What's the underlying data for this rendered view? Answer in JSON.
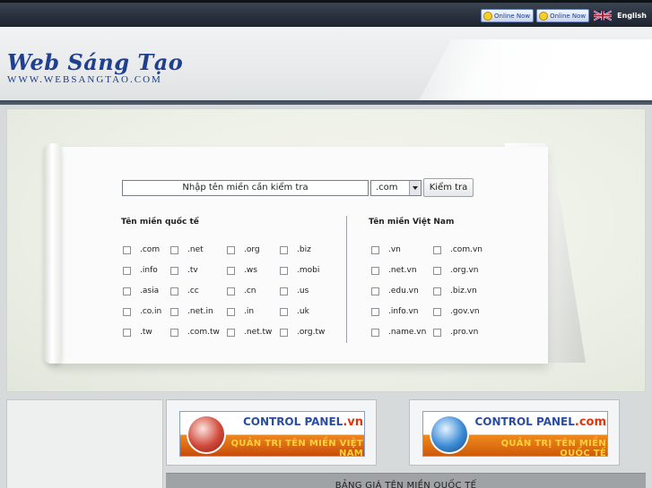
{
  "topbar": {
    "online_buttons": [
      {
        "label": "Online Now"
      },
      {
        "label": "Online Now"
      }
    ],
    "language": "English"
  },
  "header": {
    "logo_title": "Web Sáng Tạo",
    "logo_url_text": "WWW.WEBSANGTAO.COM"
  },
  "search": {
    "input_value": "Nhập tên miền cần kiểm tra",
    "tld_selected": ".com",
    "button_label": "Kiểm tra"
  },
  "international": {
    "title": "Tên miền quốc tế",
    "columns": [
      [
        ".com",
        ".info",
        ".asia",
        ".co.in",
        ".tw"
      ],
      [
        ".net",
        ".tv",
        ".cc",
        ".net.in",
        ".com.tw"
      ],
      [
        ".org",
        ".ws",
        ".cn",
        ".in",
        ".net.tw"
      ],
      [
        ".biz",
        ".mobi",
        ".us",
        ".uk",
        ".org.tw"
      ]
    ]
  },
  "vietnam": {
    "title": "Tên miền Việt Nam",
    "columns": [
      [
        ".vn",
        ".net.vn",
        ".edu.vn",
        ".info.vn",
        ".name.vn"
      ],
      [
        ".com.vn",
        ".org.vn",
        ".biz.vn",
        ".gov.vn",
        ".pro.vn"
      ]
    ]
  },
  "control_panels": [
    {
      "title": "CONTROL PANEL",
      "ext": ".vn",
      "subtitle": "QUẢN TRỊ TÊN MIỀN VIỆT NAM"
    },
    {
      "title": "CONTROL PANEL",
      "ext": ".com",
      "subtitle": "QUẢN TRỊ TÊN MIỀN QUỐC TẾ"
    }
  ],
  "price_table": {
    "title": "BẢNG GIÁ TÊN MIỀN QUỐC TẾ"
  },
  "colors": {
    "brand": "#1f3f8f",
    "accent_orange": "#ee8a1e",
    "topbar": "#1d2430"
  }
}
